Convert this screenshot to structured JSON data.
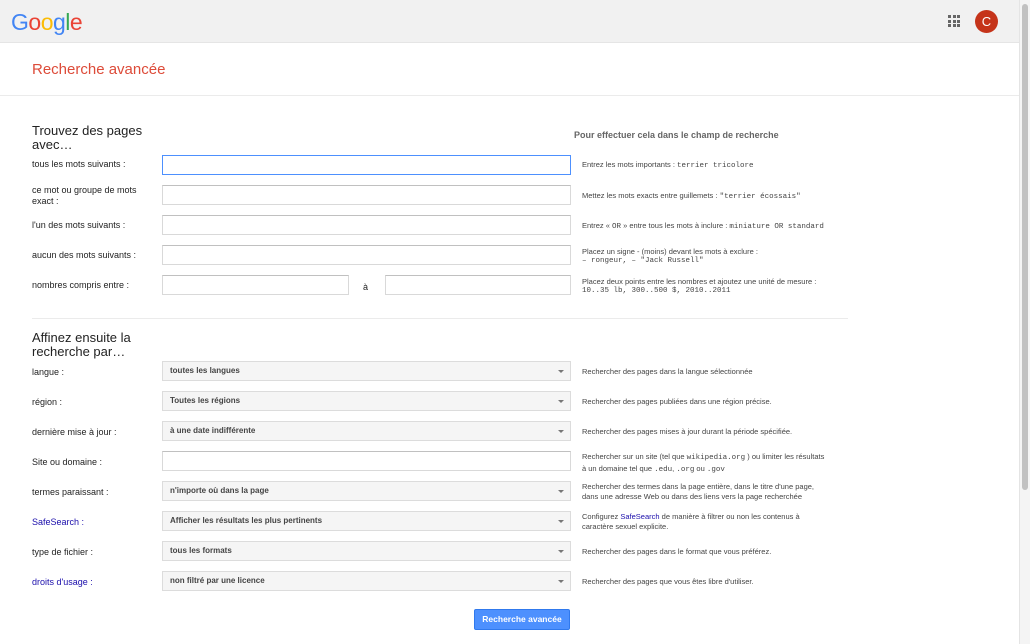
{
  "header": {
    "logo_letters": [
      {
        "char": "G",
        "color": "#4285f4"
      },
      {
        "char": "o",
        "color": "#ea4335"
      },
      {
        "char": "o",
        "color": "#fbbc05"
      },
      {
        "char": "g",
        "color": "#4285f4"
      },
      {
        "char": "l",
        "color": "#34a853"
      },
      {
        "char": "e",
        "color": "#ea4335"
      }
    ],
    "apps_icon": "apps-grid-icon",
    "avatar_letter": "C",
    "avatar_color": "#c5341a"
  },
  "page_title": "Recherche avancée",
  "find": {
    "heading_line1": "Trouvez des pages",
    "heading_line2": "avec…",
    "hint_heading": "Pour effectuer cela dans le champ de recherche",
    "all_words": {
      "label": "tous les mots suivants :",
      "value": "",
      "hint_text": "Entrez les mots importants : ",
      "hint_code": "terrier tricolore"
    },
    "exact": {
      "label_line1": "ce mot ou groupe de mots",
      "label_line2": "exact :",
      "value": "",
      "hint_text": "Mettez les mots exacts entre guillemets : ",
      "hint_code": "\"terrier écossais\""
    },
    "any_words": {
      "label": "l'un des mots suivants :",
      "value": "",
      "hint_pre": "Entrez « ",
      "hint_or": "OR",
      "hint_mid": " » entre tous les mots à inclure : ",
      "hint_code": "miniature OR standard"
    },
    "none_words": {
      "label": "aucun des mots suivants :",
      "value": "",
      "hint_text": "Placez un signe - (moins) devant les mots à exclure :",
      "hint_code": "– rongeur, – \"Jack Russell\""
    },
    "range": {
      "label": "nombres compris entre :",
      "from_value": "",
      "to_value": "",
      "and_label": "à",
      "hint_text": "Placez deux points entre les nombres et ajoutez une unité de mesure :",
      "hint_code": "10..35 lb, 300..500 $, 2010..2011"
    }
  },
  "refine": {
    "heading_line1": "Affinez ensuite la",
    "heading_line2": "recherche par…",
    "language": {
      "label": "langue :",
      "selected": "toutes les langues",
      "hint": "Rechercher des pages dans la langue sélectionnée"
    },
    "region": {
      "label": "région :",
      "selected": "Toutes les régions",
      "hint": "Rechercher des pages publiées dans une région précise."
    },
    "last_update": {
      "label": "dernière mise à jour :",
      "selected": "à une date indifférente",
      "hint": "Rechercher des pages mises à jour durant la période spécifiée."
    },
    "site": {
      "label": "Site ou domaine :",
      "value": "",
      "hint_a": "Rechercher sur un site (tel que ",
      "hint_code1": "wikipedia.org",
      "hint_b": " ) ou limiter les résultats",
      "hint_c": "à un domaine tel que ",
      "hint_code2": ".edu",
      "hint_code3": ".org",
      "hint_code4": ".gov",
      "hint_ou": " ou ",
      "hint_comma": ", "
    },
    "terms": {
      "label": "termes paraissant :",
      "selected": "n'importe où dans la page",
      "hint_line1": "Rechercher des termes dans la page entière, dans le titre d'une page,",
      "hint_line2": "dans une adresse Web ou dans des liens vers la page recherchée"
    },
    "safesearch": {
      "label": "SafeSearch :",
      "selected": "Afficher les résultats les plus pertinents",
      "hint_a": "Configurez ",
      "hint_link": "SafeSearch",
      "hint_b": " de manière à filtrer ou non les contenus à",
      "hint_line2": "caractère sexuel explicite."
    },
    "file_type": {
      "label": "type de fichier :",
      "selected": "tous les formats",
      "hint": "Rechercher des pages dans le format que vous préférez."
    },
    "usage_rights": {
      "label": "droits d'usage :",
      "selected": "non filtré par une licence",
      "hint": "Rechercher des pages que vous êtes libre d'utiliser."
    }
  },
  "submit_label": "Recherche avancée",
  "colors": {
    "accent_red": "#dd4b39",
    "link_blue": "#1a0dab",
    "button_blue": "#4d90fe"
  }
}
